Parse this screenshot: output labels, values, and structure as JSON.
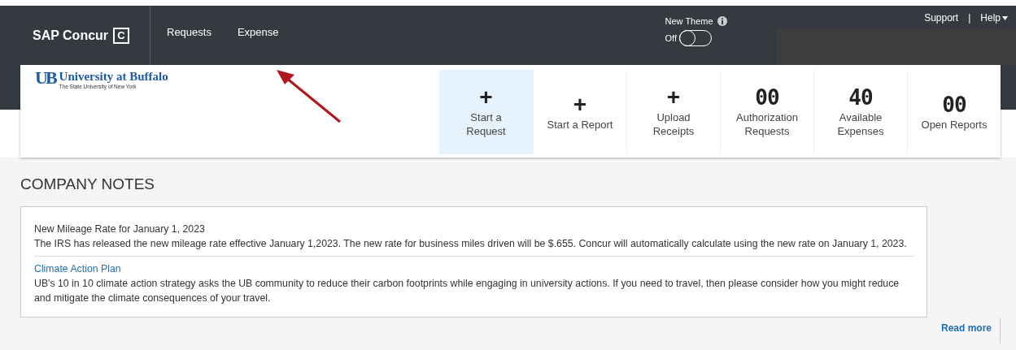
{
  "header": {
    "brand": "SAP Concur",
    "brand_mark": "C",
    "nav": [
      {
        "label": "Requests",
        "selected": false
      },
      {
        "label": "Expense",
        "selected": false
      }
    ],
    "new_theme": {
      "label": "New Theme",
      "state_label": "Off",
      "on": false
    },
    "links": [
      "Support",
      "|",
      "Help"
    ]
  },
  "banner": {
    "org_name": "University at Buffalo",
    "org_subtitle": "The State University of New York",
    "logo_text": "UB"
  },
  "tiles": [
    {
      "kind": "action",
      "icon": "+",
      "label": "Start a Request",
      "selected": true
    },
    {
      "kind": "action",
      "icon": "+",
      "label": "Start a Report",
      "selected": false
    },
    {
      "kind": "action",
      "icon": "+",
      "label": "Upload Receipts",
      "selected": false
    },
    {
      "kind": "count",
      "count": "00",
      "label": "Authorization Requests",
      "selected": false
    },
    {
      "kind": "count",
      "count": "40",
      "label": "Available Expenses",
      "selected": false
    },
    {
      "kind": "count",
      "count": "00",
      "label": "Open Reports",
      "selected": false
    }
  ],
  "company_notes": {
    "title": "COMPANY NOTES",
    "notes": [
      {
        "kind": "plain",
        "title": "New Mileage Rate for January 1, 2023",
        "body": "The IRS has released the new mileage rate effective January 1,2023.  The new rate for business miles driven will be $.655.  Concur will automatically calculate using the new rate on January 1, 2023."
      },
      {
        "kind": "link",
        "title": "Climate Action Plan",
        "body": "UB's 10 in 10 climate action strategy asks the UB community to reduce their carbon footprints while engaging in university actions. If you need to travel, then please consider how you might reduce and mitigate the climate consequences of your travel."
      }
    ],
    "read_more": "Read more"
  }
}
